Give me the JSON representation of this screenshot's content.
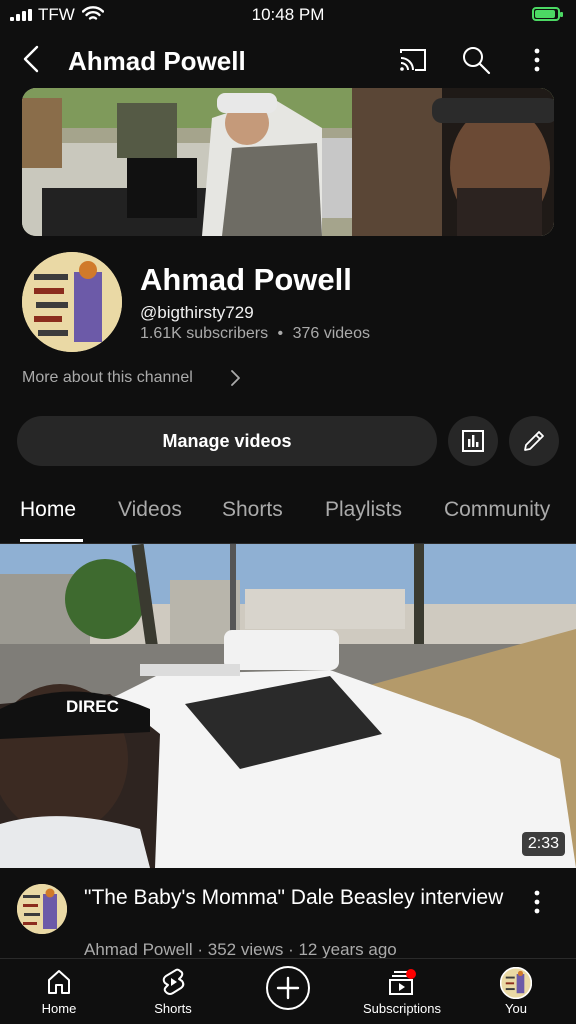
{
  "status_bar": {
    "carrier": "TFW",
    "time": "10:48 PM"
  },
  "header": {
    "title": "Ahmad Powell"
  },
  "channel": {
    "name": "Ahmad Powell",
    "handle": "@bigthirsty729",
    "subscribers": "1.61K subscribers",
    "videos": "376 videos",
    "separator": "•",
    "more_link": "More about this channel",
    "manage_button": "Manage videos"
  },
  "tabs": [
    {
      "label": "Home",
      "active": true
    },
    {
      "label": "Videos",
      "active": false
    },
    {
      "label": "Shorts",
      "active": false
    },
    {
      "label": "Playlists",
      "active": false
    },
    {
      "label": "Community",
      "active": false
    }
  ],
  "video": {
    "duration": "2:33",
    "title": "\"The Baby's Momma\" Dale Beasley interview",
    "meta": "Ahmad Powell · 352 views · 12 years ago",
    "overlay_text": "DIREC"
  },
  "bottom_nav": [
    {
      "label": "Home",
      "icon": "home-icon"
    },
    {
      "label": "Shorts",
      "icon": "shorts-icon"
    },
    {
      "label": "",
      "icon": "create-icon"
    },
    {
      "label": "Subscriptions",
      "icon": "subscriptions-icon"
    },
    {
      "label": "You",
      "icon": "you-avatar"
    }
  ],
  "colors": {
    "background": "#0f0f0f",
    "surface": "#272727",
    "battery": "#4cd964",
    "notification": "#ff0000"
  }
}
